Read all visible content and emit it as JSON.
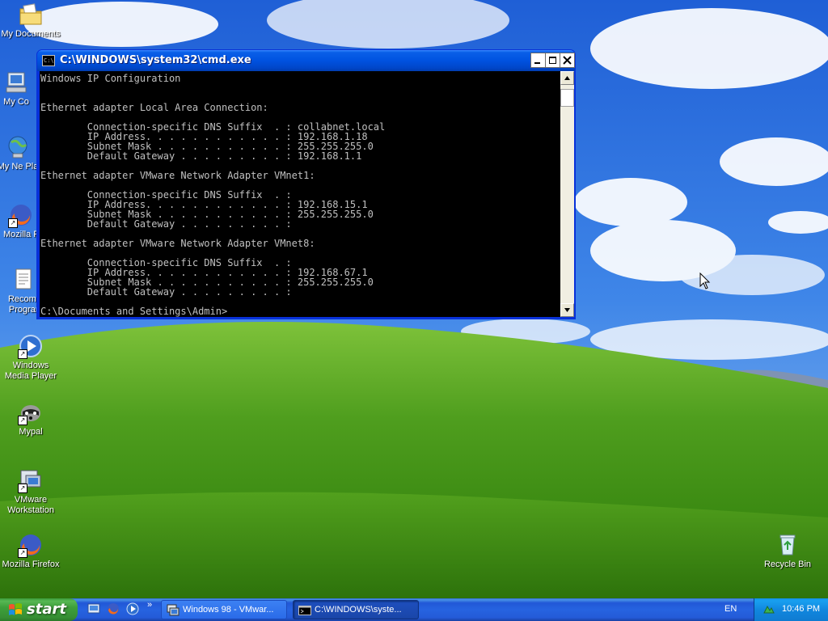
{
  "desktop": {
    "icons": [
      {
        "label": "My Documents"
      },
      {
        "label": "My Co"
      },
      {
        "label": "My Ne Pla"
      },
      {
        "label": "Mozilla F"
      },
      {
        "label": "Recomm Program"
      },
      {
        "label": "Windows Media Player"
      },
      {
        "label": "Mypal"
      },
      {
        "label": "VMware Workstation"
      },
      {
        "label": "Mozilla Firefox"
      },
      {
        "label": "Recycle Bin"
      }
    ]
  },
  "cmd_window": {
    "title": "C:\\WINDOWS\\system32\\cmd.exe",
    "icon_text": "C:\\",
    "lines": [
      "Windows IP Configuration",
      "",
      "",
      "Ethernet adapter Local Area Connection:",
      "",
      "        Connection-specific DNS Suffix  . : collabnet.local",
      "        IP Address. . . . . . . . . . . . : 192.168.1.18",
      "        Subnet Mask . . . . . . . . . . . : 255.255.255.0",
      "        Default Gateway . . . . . . . . . : 192.168.1.1",
      "",
      "Ethernet adapter VMware Network Adapter VMnet1:",
      "",
      "        Connection-specific DNS Suffix  . :",
      "        IP Address. . . . . . . . . . . . : 192.168.15.1",
      "        Subnet Mask . . . . . . . . . . . : 255.255.255.0",
      "        Default Gateway . . . . . . . . . :",
      "",
      "Ethernet adapter VMware Network Adapter VMnet8:",
      "",
      "        Connection-specific DNS Suffix  . :",
      "        IP Address. . . . . . . . . . . . : 192.168.67.1",
      "        Subnet Mask . . . . . . . . . . . : 255.255.255.0",
      "        Default Gateway . . . . . . . . . :",
      "",
      "C:\\Documents and Settings\\Admin>"
    ]
  },
  "taskbar": {
    "start_label": "start",
    "quick_launch_more": "»",
    "tasks": [
      {
        "label": "Windows 98 - VMwar..."
      },
      {
        "label": "C:\\WINDOWS\\syste..."
      }
    ],
    "language": "EN",
    "clock": "10:46 PM"
  }
}
